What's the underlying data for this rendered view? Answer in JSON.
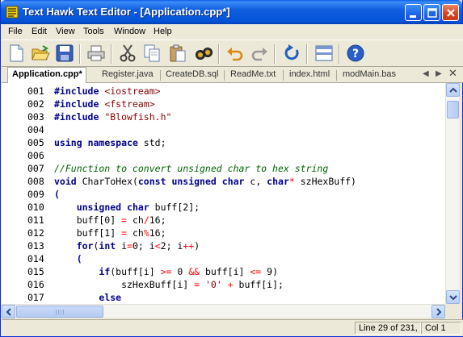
{
  "window": {
    "title": "Text Hawk Text Editor - [Application.cpp*]"
  },
  "menu": [
    "File",
    "Edit",
    "View",
    "Tools",
    "Window",
    "Help"
  ],
  "toolbar": {
    "icons": [
      "new-file-icon",
      "open-folder-icon",
      "save-icon",
      "print-icon",
      "cut-icon",
      "copy-icon",
      "paste-icon",
      "find-icon",
      "undo-icon",
      "redo-icon",
      "refresh-icon",
      "split-view-icon",
      "help-icon"
    ]
  },
  "tabs": [
    "Application.cpp*",
    "Register.java",
    "CreateDB.sql",
    "ReadMe.txt",
    "index.html",
    "modMain.bas"
  ],
  "tab_controls": {
    "left": "◀",
    "right": "▶",
    "close": "✕"
  },
  "editor": {
    "lines": [
      {
        "num": "001",
        "tokens": [
          [
            "pp",
            "#include"
          ],
          [
            "pl",
            " "
          ],
          [
            "str",
            "<iostream>"
          ]
        ]
      },
      {
        "num": "002",
        "tokens": [
          [
            "pp",
            "#include"
          ],
          [
            "pl",
            " "
          ],
          [
            "str",
            "<fstream>"
          ]
        ]
      },
      {
        "num": "003",
        "tokens": [
          [
            "pp",
            "#include"
          ],
          [
            "pl",
            " "
          ],
          [
            "str",
            "\"Blowfish.h\""
          ]
        ]
      },
      {
        "num": "004",
        "tokens": []
      },
      {
        "num": "005",
        "tokens": [
          [
            "kw",
            "using"
          ],
          [
            "pl",
            " "
          ],
          [
            "kw",
            "namespace"
          ],
          [
            "pl",
            " std;"
          ]
        ]
      },
      {
        "num": "006",
        "tokens": []
      },
      {
        "num": "007",
        "tokens": [
          [
            "cm",
            "//Function to convert unsigned char to hex string"
          ]
        ]
      },
      {
        "num": "008",
        "tokens": [
          [
            "kw",
            "void"
          ],
          [
            "pl",
            " CharToHex("
          ],
          [
            "kw",
            "const"
          ],
          [
            "pl",
            " "
          ],
          [
            "kw",
            "unsigned"
          ],
          [
            "pl",
            " "
          ],
          [
            "kw",
            "char"
          ],
          [
            "pl",
            " c, "
          ],
          [
            "kw",
            "char"
          ],
          [
            "op",
            "*"
          ],
          [
            "pl",
            " szHexBuff)"
          ]
        ]
      },
      {
        "num": "009",
        "tokens": [
          [
            "kw",
            "("
          ]
        ]
      },
      {
        "num": "010",
        "tokens": [
          [
            "pl",
            "    "
          ],
          [
            "kw",
            "unsigned"
          ],
          [
            "pl",
            " "
          ],
          [
            "kw",
            "char"
          ],
          [
            "pl",
            " buff[2];"
          ]
        ]
      },
      {
        "num": "011",
        "tokens": [
          [
            "pl",
            "    buff[0] "
          ],
          [
            "op",
            "="
          ],
          [
            "pl",
            " ch"
          ],
          [
            "op",
            "/"
          ],
          [
            "pl",
            "16;"
          ]
        ]
      },
      {
        "num": "012",
        "tokens": [
          [
            "pl",
            "    buff[1] "
          ],
          [
            "op",
            "="
          ],
          [
            "pl",
            " ch"
          ],
          [
            "op",
            "%"
          ],
          [
            "pl",
            "16;"
          ]
        ]
      },
      {
        "num": "013",
        "tokens": [
          [
            "pl",
            "    "
          ],
          [
            "kw",
            "for"
          ],
          [
            "pl",
            "("
          ],
          [
            "kw",
            "int"
          ],
          [
            "pl",
            " i"
          ],
          [
            "op",
            "="
          ],
          [
            "pl",
            "0; i"
          ],
          [
            "op",
            "<"
          ],
          [
            "pl",
            "2; i"
          ],
          [
            "op",
            "++"
          ],
          [
            "pl",
            ")"
          ]
        ]
      },
      {
        "num": "014",
        "tokens": [
          [
            "pl",
            "    "
          ],
          [
            "kw",
            "("
          ]
        ]
      },
      {
        "num": "015",
        "tokens": [
          [
            "pl",
            "        "
          ],
          [
            "kw",
            "if"
          ],
          [
            "pl",
            "(buff[i] "
          ],
          [
            "op",
            ">="
          ],
          [
            "pl",
            " 0 "
          ],
          [
            "op",
            "&&"
          ],
          [
            "pl",
            " buff[i] "
          ],
          [
            "op",
            "<="
          ],
          [
            "pl",
            " 9)"
          ]
        ]
      },
      {
        "num": "016",
        "tokens": [
          [
            "pl",
            "            szHexBuff[i] "
          ],
          [
            "op",
            "="
          ],
          [
            "pl",
            " "
          ],
          [
            "str",
            "'0'"
          ],
          [
            "pl",
            " "
          ],
          [
            "op",
            "+"
          ],
          [
            "pl",
            " buff[i];"
          ]
        ]
      },
      {
        "num": "017",
        "tokens": [
          [
            "pl",
            "        "
          ],
          [
            "kw",
            "else"
          ]
        ]
      }
    ]
  },
  "status": {
    "position": "Line 29 of 231,",
    "column": "Col 1"
  },
  "colors": {
    "title_bar": "#0553d8",
    "keyword": "#00008b",
    "string": "#8b0000",
    "comment": "#006400",
    "operator": "#ff0000"
  }
}
